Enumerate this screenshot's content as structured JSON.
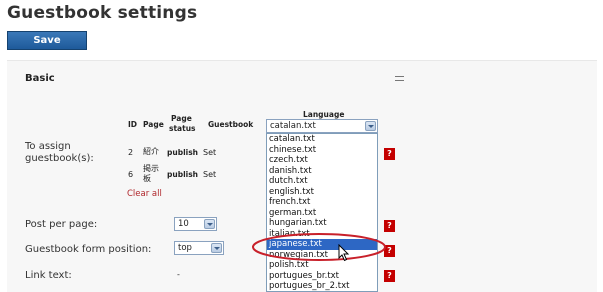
{
  "page": {
    "title": "Guestbook settings"
  },
  "toolbar": {
    "save_label": "Save"
  },
  "section": {
    "title": "Basic"
  },
  "assign": {
    "label_line1": "To assign",
    "label_line2": "guestbook(s):",
    "headers": {
      "id": "ID",
      "page": "Page",
      "status_line1": "Page",
      "status_line2": "status",
      "guestbook": "Guestbook",
      "language": "Language"
    },
    "rows": [
      {
        "id": "2",
        "page": "紹介",
        "status": "publish",
        "action": "Set"
      },
      {
        "id": "6",
        "page_line1": "掲示",
        "page_line2": "板",
        "status": "publish",
        "action": "Set"
      }
    ],
    "clear_all": "Clear all"
  },
  "language": {
    "selected": "catalan.txt",
    "options": [
      "catalan.txt",
      "chinese.txt",
      "czech.txt",
      "danish.txt",
      "dutch.txt",
      "english.txt",
      "french.txt",
      "german.txt",
      "hungarian.txt",
      "italian.txt",
      "japanese.txt",
      "norwegian.txt",
      "polish.txt",
      "portugues_br.txt",
      "portugues_br_2.txt"
    ],
    "highlighted": "japanese.txt"
  },
  "post_per_page": {
    "label": "Post per page:",
    "value": "10"
  },
  "form_position": {
    "label": "Guestbook form position:",
    "value": "top"
  },
  "link_text": {
    "label": "Link text:",
    "value": "-"
  },
  "help": {
    "glyph": "?"
  },
  "colors": {
    "accent": "#1e5a9a",
    "help_red": "#c40000",
    "selection_blue": "#2d67c4",
    "annotation_red": "#c8202a"
  }
}
